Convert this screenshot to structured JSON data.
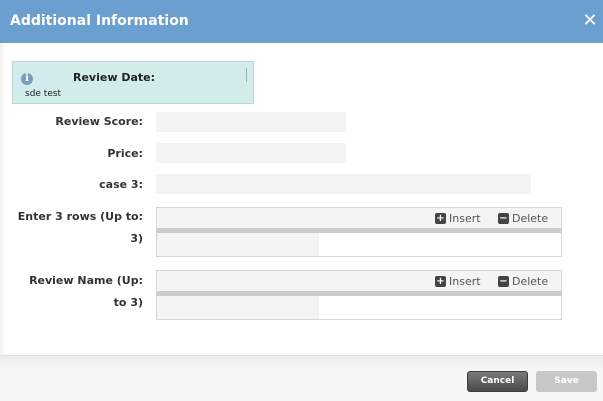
{
  "dialog": {
    "title": "Additional Information",
    "close_icon": "close-icon",
    "title_color": "#6b9fd0"
  },
  "info": {
    "icon": "info-icon",
    "label": "Review Date:",
    "value": "sde test"
  },
  "fields": {
    "review_score": {
      "label": "Review Score:",
      "value": ""
    },
    "price": {
      "label": "Price:",
      "value": ""
    },
    "case3": {
      "label": "case 3:",
      "value": ""
    }
  },
  "grids": {
    "enter_rows": {
      "label_line1": "Enter 3 rows (Up to:",
      "label_line2": "3)",
      "insert_label": "Insert",
      "delete_label": "Delete"
    },
    "review_name": {
      "label_line1": "Review Name (Up:",
      "label_line2": "to 3)",
      "insert_label": "Insert",
      "delete_label": "Delete"
    }
  },
  "footer": {
    "cancel_label": "Cancel",
    "save_label": "Save"
  }
}
